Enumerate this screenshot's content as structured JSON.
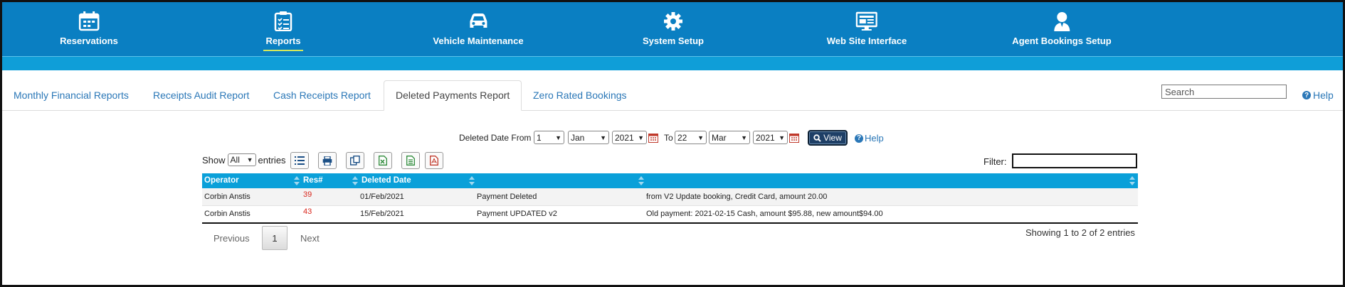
{
  "nav": {
    "items": [
      {
        "label": "Reservations",
        "icon": "calendar-icon"
      },
      {
        "label": "Reports",
        "icon": "clipboard-list-icon",
        "active": true
      },
      {
        "label": "Vehicle Maintenance",
        "icon": "car-icon"
      },
      {
        "label": "System Setup",
        "icon": "gear-icon"
      },
      {
        "label": "Web Site Interface",
        "icon": "monitor-icon"
      },
      {
        "label": "Agent Bookings Setup",
        "icon": "agent-user-icon"
      }
    ]
  },
  "colors": {
    "nav_bg": "#0a7fc2",
    "subbar": "#0f9ed8",
    "table_header": "#0aa0d9",
    "link": "#2a77b7",
    "res_number": "#d9261c",
    "active_underline": "#d5e85a"
  },
  "tabs": [
    {
      "label": "Monthly Financial Reports"
    },
    {
      "label": "Receipts Audit Report"
    },
    {
      "label": "Cash Receipts Report"
    },
    {
      "label": "Deleted Payments Report",
      "active": true
    },
    {
      "label": "Zero Rated Bookings"
    }
  ],
  "search": {
    "placeholder": "Search"
  },
  "help_label": "Help",
  "date_filter": {
    "from_label": "Deleted Date From",
    "from_day": "1",
    "from_month": "Jan",
    "from_year": "2021",
    "to_label": "To",
    "to_day": "22",
    "to_month": "Mar",
    "to_year": "2021",
    "view_label": "View",
    "help_label": "Help"
  },
  "table_controls": {
    "show_label": "Show",
    "entries_value": "All",
    "entries_label": "entries",
    "filter_label": "Filter:"
  },
  "table": {
    "headers": [
      "Operator",
      "Res#",
      "Deleted Date",
      "",
      ""
    ],
    "rows": [
      {
        "operator": "Corbin Anstis",
        "res": "39",
        "date": "01/Feb/2021",
        "action": "Payment Deleted",
        "detail": "from V2 Update booking, Credit Card, amount 20.00"
      },
      {
        "operator": "Corbin Anstis",
        "res": "43",
        "date": "15/Feb/2021",
        "action": "Payment UPDATED v2",
        "detail": "Old payment: 2021-02-15 Cash, amount $95.88, new amount$94.00"
      }
    ]
  },
  "pagination": {
    "previous": "Previous",
    "current": "1",
    "next": "Next",
    "info": "Showing 1 to 2 of 2 entries"
  }
}
